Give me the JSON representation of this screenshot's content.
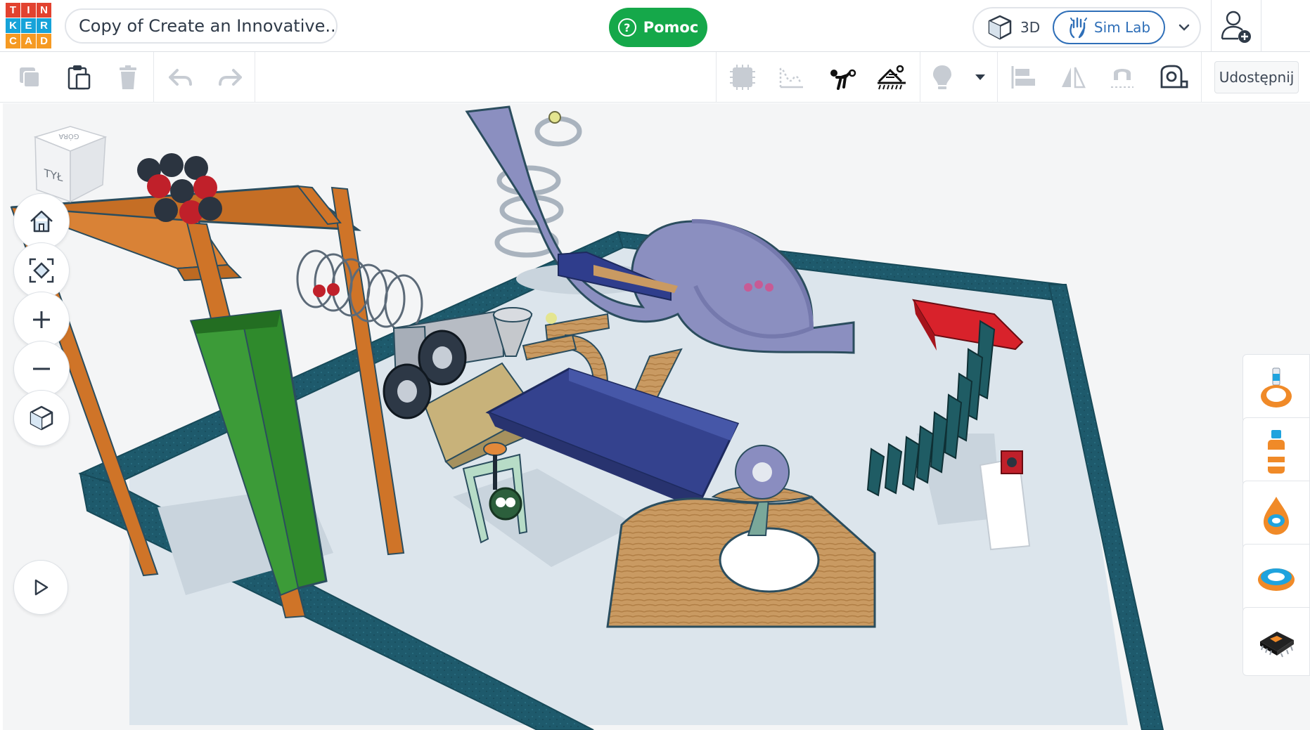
{
  "app": {
    "logo_letters": [
      "T",
      "I",
      "N",
      "K",
      "E",
      "R",
      "C",
      "A",
      "D"
    ],
    "logo_colors": [
      "#e2422f",
      "#e2422f",
      "#e2422f",
      "#16a3d9",
      "#16a3d9",
      "#16a3d9",
      "#f59a23",
      "#f59a23",
      "#f59a23"
    ],
    "design_title": "Copy of Create an Innovative...",
    "help_label": "Pomoc",
    "help_color": "#15a84a"
  },
  "mode_switch": {
    "three_d_label": "3D",
    "sim_lab_label": "Sim Lab",
    "active": "Sim Lab",
    "accent": "#2f6fb8"
  },
  "toolbar": {
    "left_icons": [
      "copy-icon",
      "paste-icon",
      "trash-icon",
      "undo-icon",
      "redo-icon"
    ],
    "right_icons": [
      "grid-block-icon",
      "curve-path-icon",
      "physics-throw-icon",
      "scene-wind-icon",
      "lightbulb-icon",
      "dropdown-arrow-icon",
      "align-icon",
      "mirror-icon",
      "magnet-icon",
      "measure-tool-icon"
    ],
    "share_label": "Udostępnij"
  },
  "view_cube": {
    "top_label": "GÓRA",
    "front_label": "TYŁ"
  },
  "view_controls": [
    "home-icon",
    "fit-view-icon",
    "zoom-in-icon",
    "zoom-out-icon",
    "perspective-icon"
  ],
  "play_control": "play-icon",
  "shape_panel": {
    "items": [
      "dropper-orange-icon",
      "bottle-orange-icon",
      "drop-orange-icon",
      "ring-orange-icon",
      "chip-component-icon"
    ]
  },
  "colors": {
    "workplane": "#dfe7ee",
    "border_wall": "#1f5c6e",
    "orange_part": "#cf7428",
    "slide_blue": "#8b8fc0",
    "ramp_blue": "#34428e",
    "red_block": "#d8222b",
    "green_box": "#2f8a2c"
  }
}
